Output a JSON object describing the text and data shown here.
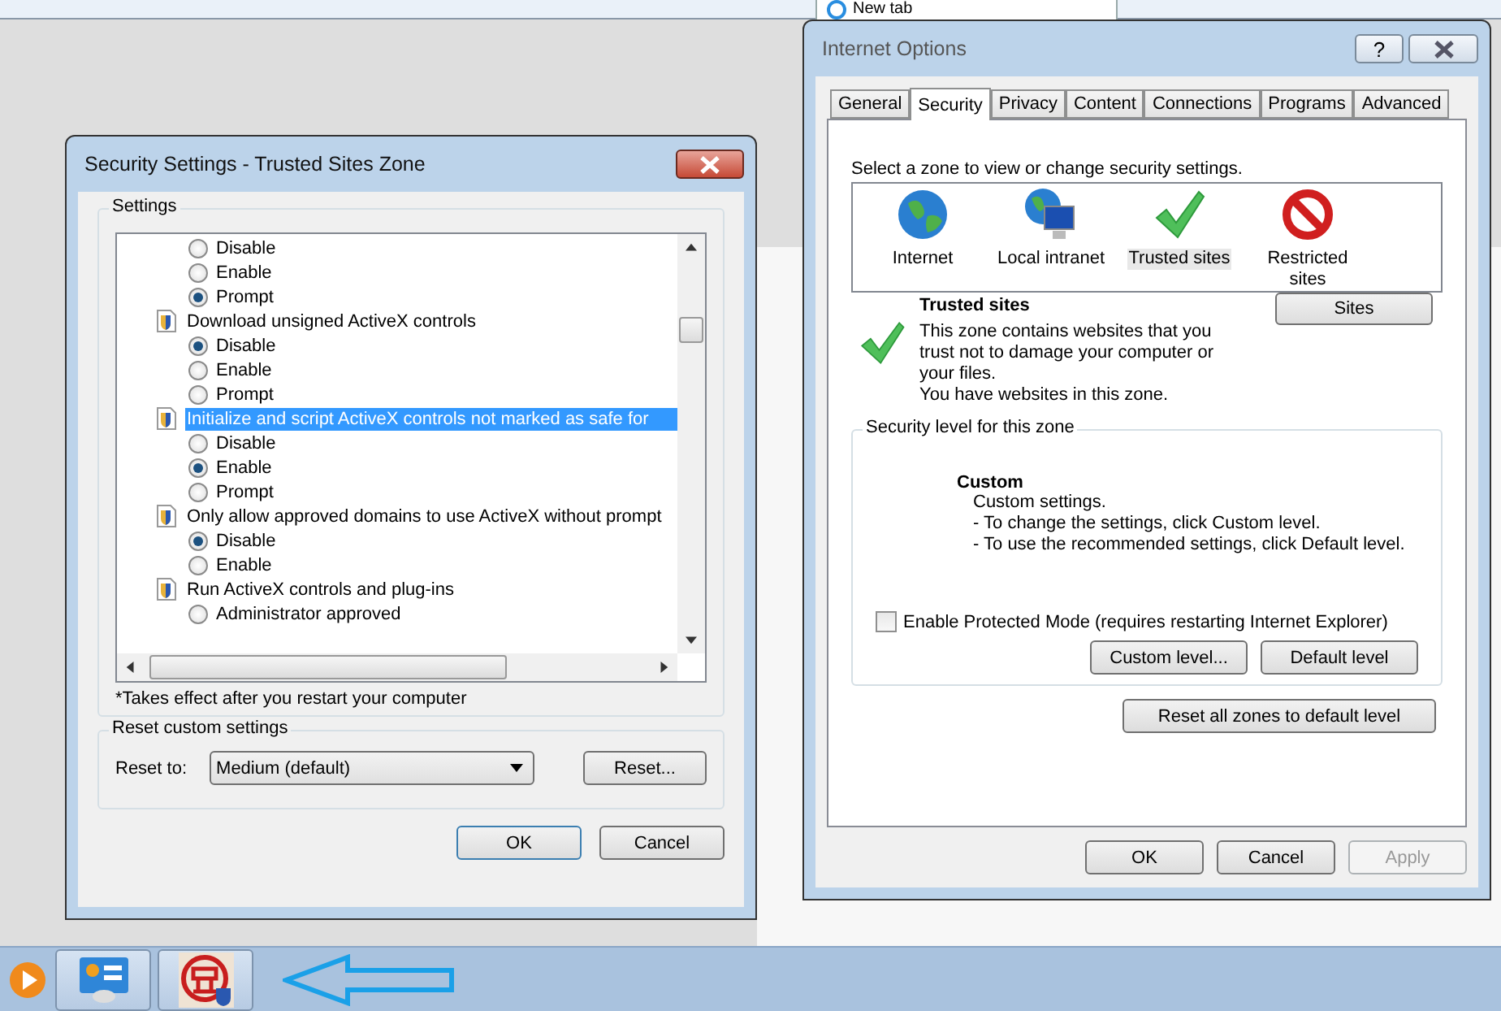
{
  "browser_tab": {
    "title": "New tab"
  },
  "security_settings": {
    "title": "Security Settings - Trusted Sites Zone",
    "settings_label": "Settings",
    "items": [
      {
        "kind": "option",
        "label": "Disable",
        "selected": false
      },
      {
        "kind": "option",
        "label": "Enable",
        "selected": false
      },
      {
        "kind": "option",
        "label": "Prompt",
        "selected": true
      },
      {
        "kind": "setting",
        "label": "Download unsigned ActiveX controls",
        "selected": false,
        "children": [
          {
            "label": "Disable",
            "selected": true
          },
          {
            "label": "Enable",
            "selected": false
          },
          {
            "label": "Prompt",
            "selected": false
          }
        ]
      },
      {
        "kind": "setting",
        "label": "Initialize and script ActiveX controls not marked as safe for",
        "selected": true,
        "children": [
          {
            "label": "Disable",
            "selected": false
          },
          {
            "label": "Enable",
            "selected": true
          },
          {
            "label": "Prompt",
            "selected": false
          }
        ]
      },
      {
        "kind": "setting",
        "label": "Only allow approved domains to use ActiveX without prompt",
        "selected": false,
        "children": [
          {
            "label": "Disable",
            "selected": true
          },
          {
            "label": "Enable",
            "selected": false
          }
        ]
      },
      {
        "kind": "setting",
        "label": "Run ActiveX controls and plug-ins",
        "selected": false,
        "children": [
          {
            "label": "Administrator approved",
            "selected": false
          }
        ]
      }
    ],
    "note": "*Takes effect after you restart your computer",
    "reset_group_label": "Reset custom settings",
    "reset_to_label": "Reset to:",
    "reset_to_value": "Medium (default)",
    "reset_button": "Reset...",
    "buttons": [
      {
        "label": "OK",
        "default": true
      },
      {
        "label": "Cancel",
        "default": false
      }
    ]
  },
  "internet_options": {
    "title": "Internet Options",
    "help_button": "?",
    "tabs": [
      {
        "label": "General",
        "selected": false
      },
      {
        "label": "Security",
        "selected": true
      },
      {
        "label": "Privacy",
        "selected": false
      },
      {
        "label": "Content",
        "selected": false
      },
      {
        "label": "Connections",
        "selected": false
      },
      {
        "label": "Programs",
        "selected": false
      },
      {
        "label": "Advanced",
        "selected": false
      }
    ],
    "zone_prompt": "Select a zone to view or change security settings.",
    "zones": [
      {
        "kind": "internet",
        "label": "Internet",
        "selected": false
      },
      {
        "kind": "intranet",
        "label": "Local intranet",
        "selected": false
      },
      {
        "kind": "trusted",
        "label": "Trusted sites",
        "selected": true
      },
      {
        "kind": "restricted",
        "label": "Restricted sites",
        "selected": false
      }
    ],
    "zone_title": "Trusted sites",
    "zone_description": "This zone contains websites that you trust not to damage your computer or your files.",
    "zone_status": "You have websites in this zone.",
    "sites_button": "Sites",
    "level_group_label": "Security level for this zone",
    "level_name": "Custom",
    "level_lines": [
      "Custom settings.",
      "- To change the settings, click Custom level.",
      "- To use the recommended settings, click Default level."
    ],
    "protected_mode": {
      "label": "Enable Protected Mode (requires restarting Internet Explorer)",
      "checked": false
    },
    "level_buttons": [
      "Custom level...",
      "Default level"
    ],
    "reset_all_button": "Reset all zones to default level",
    "buttons": [
      {
        "label": "OK",
        "disabled": false
      },
      {
        "label": "Cancel",
        "disabled": false
      },
      {
        "label": "Apply",
        "disabled": true
      }
    ]
  }
}
